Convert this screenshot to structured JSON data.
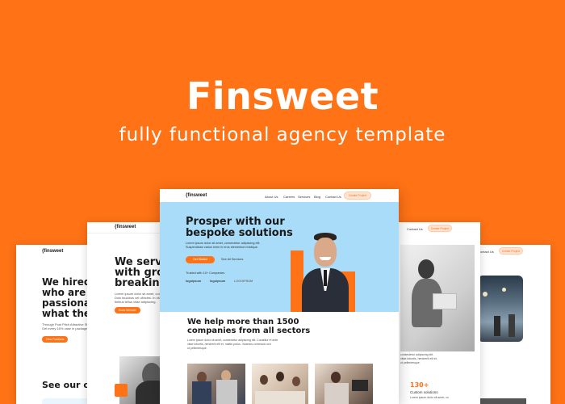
{
  "hero": {
    "title": "Finsweet",
    "subtitle": "fully functional agency template"
  },
  "center_card": {
    "logo": "{finsweet",
    "nav": [
      "About Us",
      "Careers",
      "Services",
      "Blog",
      "Contact Us"
    ],
    "cta": "Create Project",
    "heading_line1": "Prosper with our",
    "heading_line2": "bespoke solutions",
    "desc1": "Lorem ipsum dolor sit amet, consectetur adipiscing elit.",
    "desc2": "Suspendisse varius enim in eros elementum tristique.",
    "primary_btn": "Get Started",
    "secondary_btn": "See All Services",
    "trusted": "Trusted with 10+ Companies",
    "logos": [
      "logoipsum",
      "logoipsum",
      "LOGOIPSUM"
    ],
    "section_title1": "We help more than 1500",
    "section_title2": "companies from all sectors",
    "section_desc1": "Lorem ipsum dolor sit amet, consectetur adipiscing elit. Curabitur et ante",
    "section_desc2": "vitae lobortis, hendrerit elit et, mattis purus. Vivamus commodo orci",
    "section_desc3": "ut pellentesque."
  },
  "card_left": {
    "logo": "{finsweet",
    "heading1": "We hired",
    "heading2": "who are v",
    "heading3": "passionat",
    "heading4": "what the",
    "desc1": "Through Post Pitch Attractive Stati",
    "desc2": "Get every 16% case in packages",
    "btn": "View Positions",
    "open": "See our ope"
  },
  "card_second": {
    "logo": "{finsweet",
    "heading1": "We serve",
    "heading2": "with grou",
    "heading3": "breaking",
    "desc1": "Lorem ipsum dolor sit amet, conse",
    "desc2": "Duis faucibus vel ultricies. In vitae",
    "desc3": "finibus tellus vitae adipiscing.",
    "btn": "Book Website"
  },
  "card_fourth": {
    "nav": "Contact Us",
    "cta": "Create Project",
    "desc1": "consectetur adipiscing elit.",
    "desc2": "vitae lobortis, hendrerit elit et,",
    "desc3": "ut pellentesque.",
    "stat": "130+",
    "stat_label": "Custom solutions",
    "stat_desc": "Lorem ipsum dolor sit amet, co"
  },
  "card_fifth": {
    "nav": "Contact Us",
    "cta": "Create Project"
  },
  "colors": {
    "brand": "#FF7216",
    "hero_blue": "#A9DCF8"
  }
}
